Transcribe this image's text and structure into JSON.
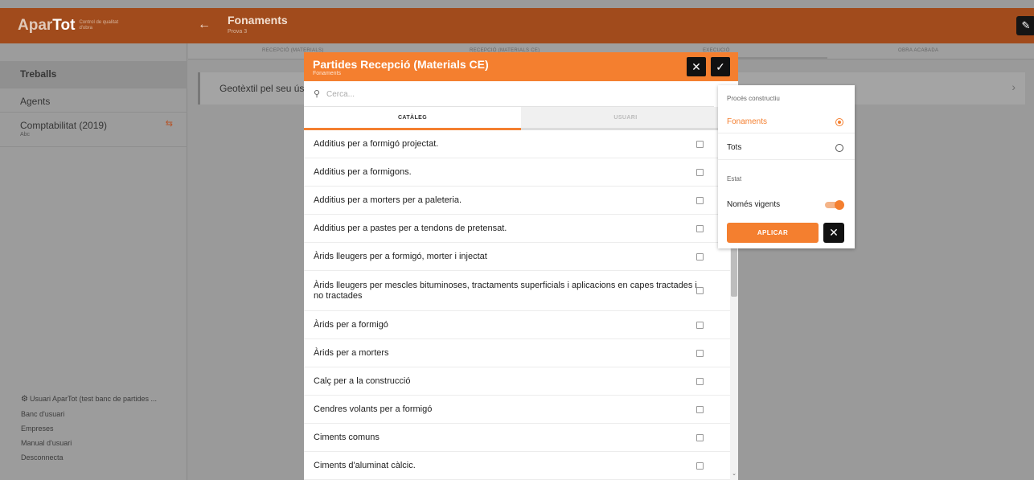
{
  "app": {
    "logo_part1": "Apar",
    "logo_part2": "Tot",
    "logo_tagline": "Control de qualitat d'obra"
  },
  "header": {
    "title": "Fonaments",
    "subtitle": "Prova 3",
    "edit_icon": "pencil-icon"
  },
  "sidebar": {
    "items": [
      {
        "label": "Treballs",
        "sub": ""
      },
      {
        "label": "Agents",
        "sub": ""
      },
      {
        "label": "Comptabilitat (2019)",
        "sub": "Abc"
      }
    ],
    "footer": {
      "user": "Usuari AparTot (test banc de partides ...",
      "links": [
        "Banc d'usuari",
        "Empreses",
        "Manual d'usuari",
        "Desconnecta"
      ]
    }
  },
  "background_tabs": [
    "RECEPCIÓ (MATERIALS)",
    "RECEPCIÓ (MATERIALS CE)",
    "EXECUCIÓ",
    "OBRA ACABADA"
  ],
  "background_card": {
    "text": "Geotèxtil pel seu ús e"
  },
  "modal": {
    "title": "Partides Recepció (Materials CE)",
    "subtitle": "Fonaments",
    "search_placeholder": "Cerca...",
    "tabs": [
      "CATÀLEG",
      "USUARI"
    ],
    "items": [
      "Additius per a formigó projectat.",
      "Additius per a formigons.",
      "Additius per a morters per a paleteria.",
      "Additius per a pastes per a tendons de pretensat.",
      "Àrids lleugers per a formigó, morter i injectat",
      "Àrids lleugers per mescles bituminoses, tractaments superficials i aplicacions en capes tractades i no tractades",
      "Àrids per a formigó",
      "Àrids per a morters",
      "Calç per a la construcció",
      "Cendres volants per a formigó",
      "Ciments comuns",
      "Ciments d'aluminat càlcic."
    ]
  },
  "filter": {
    "section1": "Procés constructiu",
    "option_selected": "Fonaments",
    "option_other": "Tots",
    "section2": "Estat",
    "toggle_label": "Només vigents",
    "toggle_on": true,
    "apply_label": "APLICAR"
  },
  "colors": {
    "accent": "#f47f2f",
    "topbar": "#a14b1c"
  }
}
